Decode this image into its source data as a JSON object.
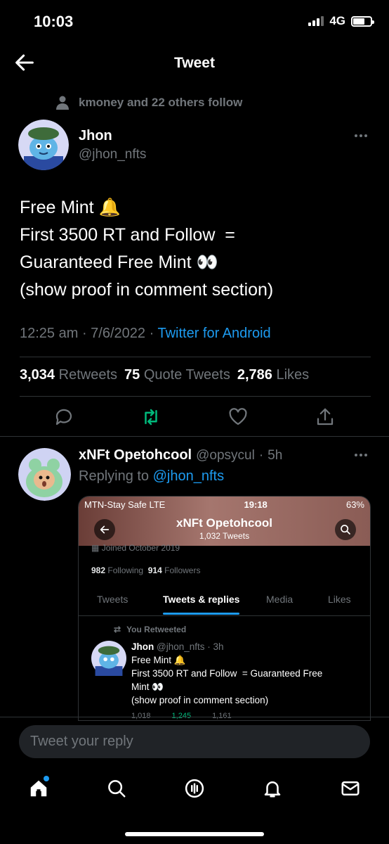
{
  "status_bar": {
    "time": "10:03",
    "network": "4G"
  },
  "header": {
    "title": "Tweet"
  },
  "social_context": "kmoney and 22 others follow",
  "tweet": {
    "name": "Jhon",
    "handle": "@jhon_nfts",
    "lines": [
      "Free Mint 🔔",
      "First 3500 RT and Follow  =",
      "Guaranteed Free Mint 👀",
      "(show proof in comment section)"
    ],
    "time": "12:25 am",
    "date": "7/6/2022",
    "source": "Twitter for Android",
    "retweets_count": "3,034",
    "retweets_label": "Retweets",
    "quotes_count": "75",
    "quotes_label": "Quote Tweets",
    "likes_count": "2,786",
    "likes_label": "Likes"
  },
  "reply": {
    "name": "xNFt Opetohcool",
    "handle": "@opsycul",
    "age": "5h",
    "replying_to_label": "Replying to",
    "replying_to_handle": "@jhon_nfts"
  },
  "embed": {
    "carrier": "MTN-Stay Safe  LTE",
    "time": "19:18",
    "battery": "63%",
    "profile_name": "xNFt Opetohcool",
    "tweet_count": "1,032 Tweets",
    "joined": "Joined October 2019",
    "following_count": "982",
    "following_label": "Following",
    "followers_count": "914",
    "followers_label": "Followers",
    "tabs": [
      "Tweets",
      "Tweets & replies",
      "Media",
      "Likes"
    ],
    "retweeted_label": "You Retweeted",
    "inner_name": "Jhon",
    "inner_handle": "@jhon_nfts · 3h",
    "inner_lines": [
      "Free Mint 🔔",
      "First 3500 RT and Follow  = Guaranteed Free",
      "Mint 👀",
      "(show proof in comment section)"
    ],
    "inner_replies": "1,018",
    "inner_retweets": "1,245",
    "inner_likes": "1,161"
  },
  "reply_bar": {
    "placeholder": "Tweet your reply"
  },
  "colors": {
    "accent": "#1d9bf0",
    "retweet_green": "#00ba7c",
    "background": "#000000"
  }
}
